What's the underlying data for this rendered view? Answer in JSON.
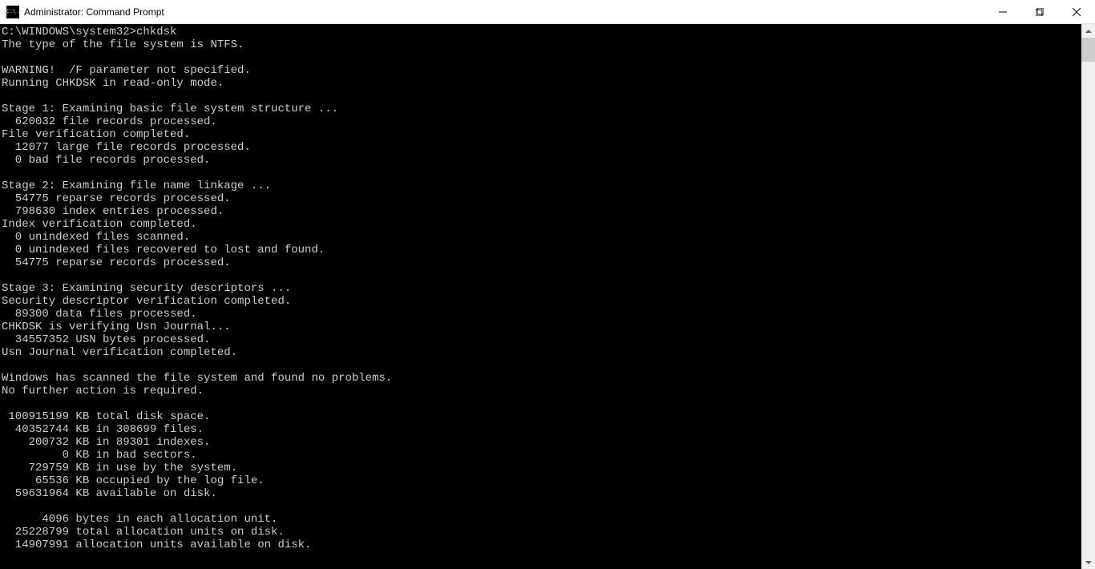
{
  "window": {
    "icon_text": "C:\\.",
    "title": "Administrator: Command Prompt"
  },
  "terminal": {
    "prompt": "C:\\WINDOWS\\system32>",
    "command": "chkdsk",
    "lines": [
      "The type of the file system is NTFS.",
      "",
      "WARNING!  /F parameter not specified.",
      "Running CHKDSK in read-only mode.",
      "",
      "Stage 1: Examining basic file system structure ...",
      "  620032 file records processed.",
      "File verification completed.",
      "  12077 large file records processed.",
      "  0 bad file records processed.",
      "",
      "Stage 2: Examining file name linkage ...",
      "  54775 reparse records processed.",
      "  798630 index entries processed.",
      "Index verification completed.",
      "  0 unindexed files scanned.",
      "  0 unindexed files recovered to lost and found.",
      "  54775 reparse records processed.",
      "",
      "Stage 3: Examining security descriptors ...",
      "Security descriptor verification completed.",
      "  89300 data files processed.",
      "CHKDSK is verifying Usn Journal...",
      "  34557352 USN bytes processed.",
      "Usn Journal verification completed.",
      "",
      "Windows has scanned the file system and found no problems.",
      "No further action is required.",
      "",
      " 100915199 KB total disk space.",
      "  40352744 KB in 308699 files.",
      "    200732 KB in 89301 indexes.",
      "         0 KB in bad sectors.",
      "    729759 KB in use by the system.",
      "     65536 KB occupied by the log file.",
      "  59631964 KB available on disk.",
      "",
      "      4096 bytes in each allocation unit.",
      "  25228799 total allocation units on disk.",
      "  14907991 allocation units available on disk."
    ]
  }
}
